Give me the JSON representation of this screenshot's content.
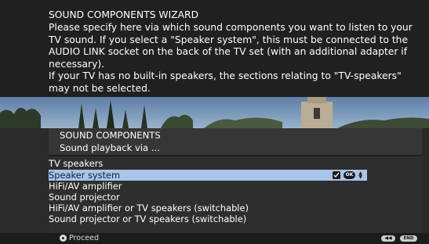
{
  "wizard": {
    "title": "SOUND COMPONENTS WIZARD",
    "description": "Please specify here via which sound components you want to listen to your TV sound. If you select a \"Speaker system\", this must be connected to the AUDIO LINK socket on the back of the TV set (with an additional adapter if necessary).\nIf your TV has no built-in speakers, the sections relating to \"TV-speakers\" may not be selected."
  },
  "menu": {
    "title": "SOUND COMPONENTS",
    "subtitle": "Sound playback via ...",
    "section_label": "TV speakers",
    "options": [
      {
        "label": "Speaker system",
        "selected": true,
        "checked": true
      },
      {
        "label": "HiFi/AV amplifier",
        "selected": false
      },
      {
        "label": "Sound projector",
        "selected": false
      },
      {
        "label": "HiFi/AV amplifier or TV speakers (switchable)",
        "selected": false
      },
      {
        "label": "Sound projector or TV speakers (switchable)",
        "selected": false
      }
    ],
    "selected_icons": {
      "ok": "OK"
    }
  },
  "footer": {
    "proceed_label": "Proceed",
    "proceed_icon": "ok-button-icon",
    "back_icon": "rewind-back-icon",
    "end_label": "END"
  },
  "colors": {
    "highlight": "#a8c6ea",
    "panel": "#2e2e2e",
    "text": "#ffffff"
  }
}
